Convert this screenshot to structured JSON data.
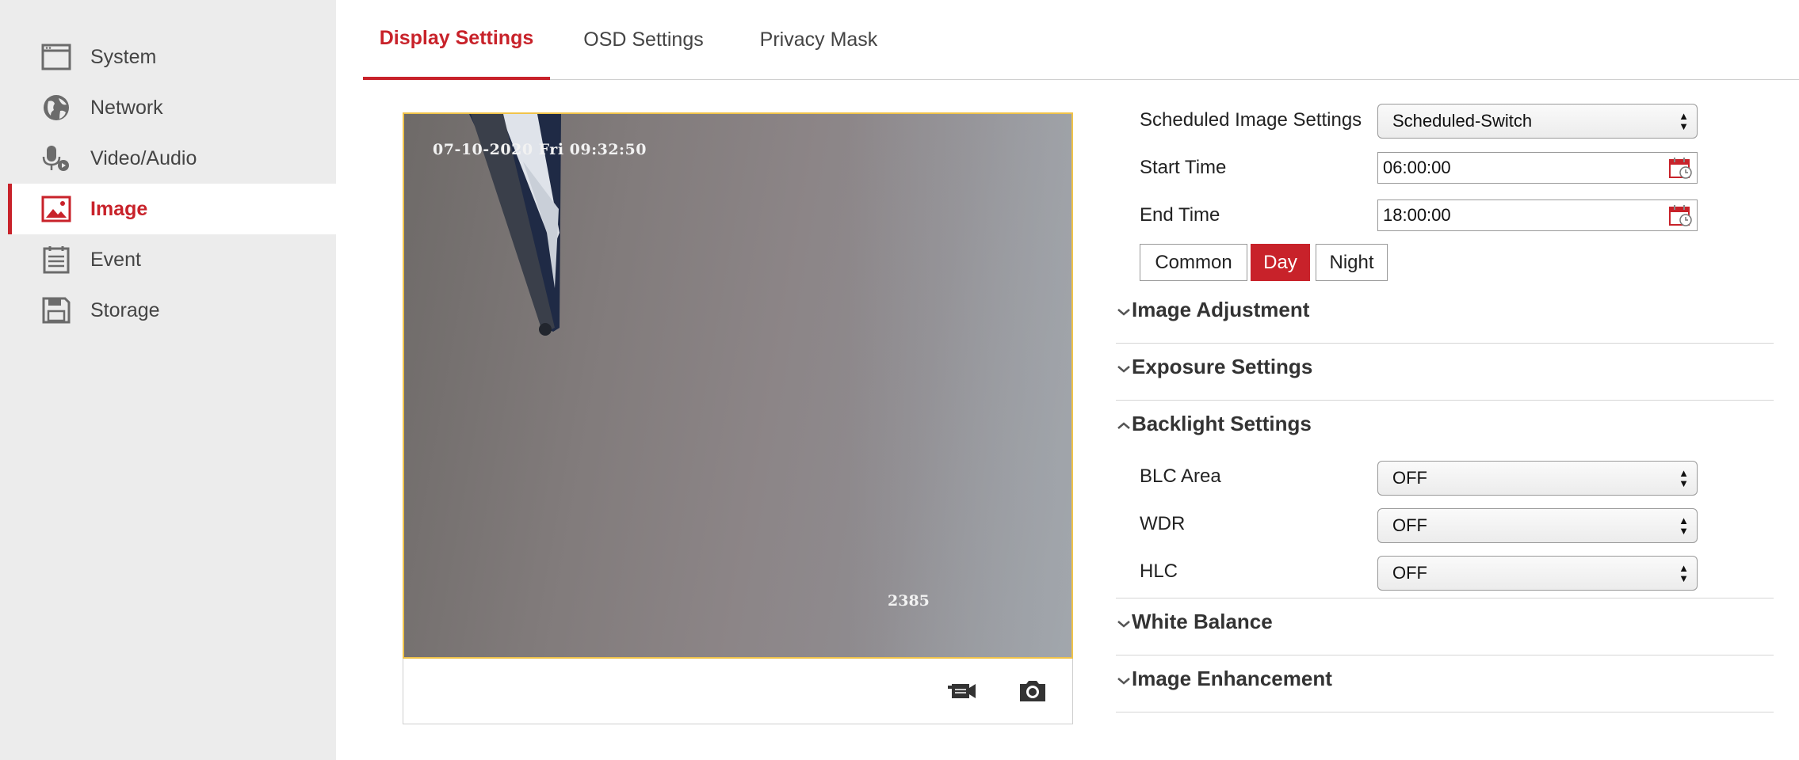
{
  "sidebar": {
    "items": [
      {
        "label": "System",
        "icon": "window-icon"
      },
      {
        "label": "Network",
        "icon": "globe-icon"
      },
      {
        "label": "Video/Audio",
        "icon": "microphone-icon"
      },
      {
        "label": "Image",
        "icon": "image-icon",
        "active": true
      },
      {
        "label": "Event",
        "icon": "calendar-list-icon"
      },
      {
        "label": "Storage",
        "icon": "floppy-disk-icon"
      }
    ]
  },
  "tabs": [
    {
      "label": "Display Settings",
      "active": true
    },
    {
      "label": "OSD Settings"
    },
    {
      "label": "Privacy Mask"
    }
  ],
  "video": {
    "timestamp": "07-10-2020 Fri 09:32:50",
    "overlay_number": "2385",
    "toolbar": {
      "record_icon": "video-record-icon",
      "snapshot_icon": "camera-snapshot-icon"
    }
  },
  "settings": {
    "scheduled": {
      "label": "Scheduled Image Settings",
      "value": "Scheduled-Switch"
    },
    "start_time": {
      "label": "Start Time",
      "value": "06:00:00"
    },
    "end_time": {
      "label": "End Time",
      "value": "18:00:00"
    },
    "modes": [
      "Common",
      "Day",
      "Night"
    ],
    "active_mode": "Day",
    "sections": {
      "image_adjustment": "Image Adjustment",
      "exposure": "Exposure Settings",
      "backlight": "Backlight Settings",
      "white_balance": "White Balance",
      "enhancement": "Image Enhancement"
    },
    "backlight": {
      "blc": {
        "label": "BLC Area",
        "value": "OFF"
      },
      "wdr": {
        "label": "WDR",
        "value": "OFF"
      },
      "hlc": {
        "label": "HLC",
        "value": "OFF"
      }
    }
  },
  "colors": {
    "accent": "#c8222a",
    "sidebar_bg": "#ececec",
    "video_border": "#f0c34a"
  }
}
